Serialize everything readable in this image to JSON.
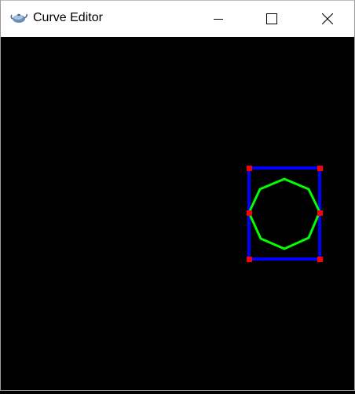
{
  "window": {
    "title": "Curve Editor",
    "app_icon": "teapot-icon",
    "controls": [
      "minimize-icon",
      "maximize-icon",
      "close-icon"
    ]
  },
  "canvas": {
    "background": "#000000",
    "colors": {
      "control_polygon": "#0000ff",
      "control_points": "#ff0000",
      "curve": "#00ff00"
    }
  }
}
